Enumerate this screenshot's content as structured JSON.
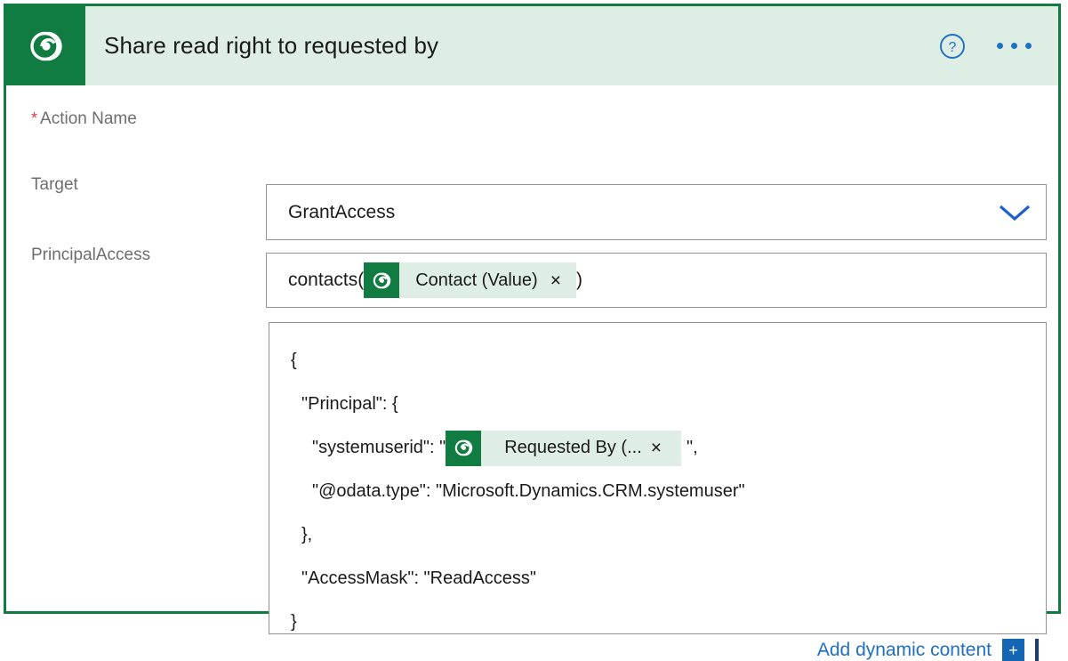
{
  "header": {
    "title": "Share read right to requested by",
    "logo_icon": "cds-logo-icon",
    "help_icon": "help-circle-icon",
    "more_icon": "ellipsis-menu-icon",
    "bg_color": "#dfeee4",
    "accent_color": "#107c41",
    "link_color": "#1f6fc4"
  },
  "fields": {
    "action_name": {
      "label": "Action Name",
      "required_marker": "*",
      "value": "GrantAccess",
      "chevron_icon": "chevron-down-icon"
    },
    "target": {
      "label": "Target",
      "prefix": "contacts(",
      "suffix": ")",
      "token": {
        "label": "Contact (Value)",
        "icon": "cds-logo-icon",
        "close": "×"
      }
    },
    "principal_access": {
      "label": "PrincipalAccess",
      "lines": [
        {
          "text": "{",
          "indent": 0
        },
        {
          "text": "\"Principal\": {",
          "indent": 1
        },
        {
          "text": "\"systemuserid\": \"",
          "indent": 2,
          "token": true,
          "after": "\","
        },
        {
          "text": "\"@odata.type\": \"Microsoft.Dynamics.CRM.systemuser\"",
          "indent": 2
        },
        {
          "text": "},",
          "indent": 1
        },
        {
          "text": "\"AccessMask\": \"ReadAccess\"",
          "indent": 1
        },
        {
          "text": "}",
          "indent": 0
        }
      ],
      "token": {
        "label": "Requested By (...",
        "icon": "cds-logo-icon",
        "close": "×"
      }
    }
  },
  "footer": {
    "add_dynamic_label": "Add dynamic content",
    "plus_label": "+",
    "plus_icon": "plus-icon"
  }
}
